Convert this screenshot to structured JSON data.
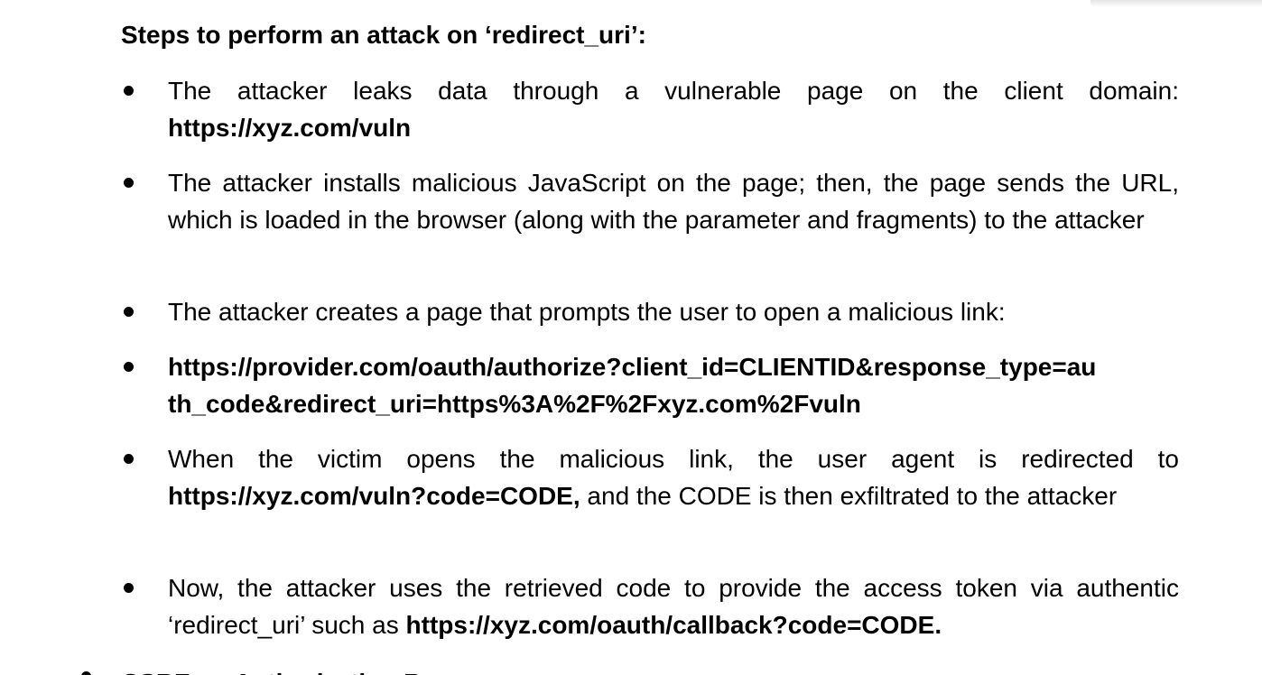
{
  "heading": "Steps to perform an attack on ‘redirect_uri’:",
  "steps": [
    {
      "parts": [
        {
          "text": "The attacker leaks data through a vulnerable page on the client domain: "
        },
        {
          "text": "https://xyz.com/vuln",
          "bold": true
        }
      ]
    },
    {
      "parts": [
        {
          "text": "The attacker installs malicious JavaScript on the page; then, the page sends the URL, which is loaded in the browser (along with the parameter and fragments) to the attacker"
        }
      ]
    },
    {
      "parts": [
        {
          "text": "The attacker creates a page that prompts the user to open a malicious link:"
        }
      ]
    },
    {
      "parts": [
        {
          "text": "https://provider.com/oauth/authorize?client_id=CLIENTID&response_type=au th_code&redirect_uri=https%3A%2F%2Fxyz.com%2Fvuln",
          "bold": true
        }
      ]
    },
    {
      "parts": [
        {
          "text": "When the victim opens the malicious link, the user agent is redirected to "
        },
        {
          "text": "https://xyz.com/vuln?code=CODE,",
          "bold": true
        },
        {
          "text": " and the CODE is then exfiltrated to the attacker"
        }
      ]
    },
    {
      "parts": [
        {
          "text": "Now, the attacker uses the retrieved code to provide the access token via authentic ‘redirect_uri’ such as "
        },
        {
          "text": "https://xyz.com/oauth/callback?code=CODE.",
          "bold": true
        }
      ]
    }
  ],
  "next_heading_partial": "CSRF on Authorization Response"
}
